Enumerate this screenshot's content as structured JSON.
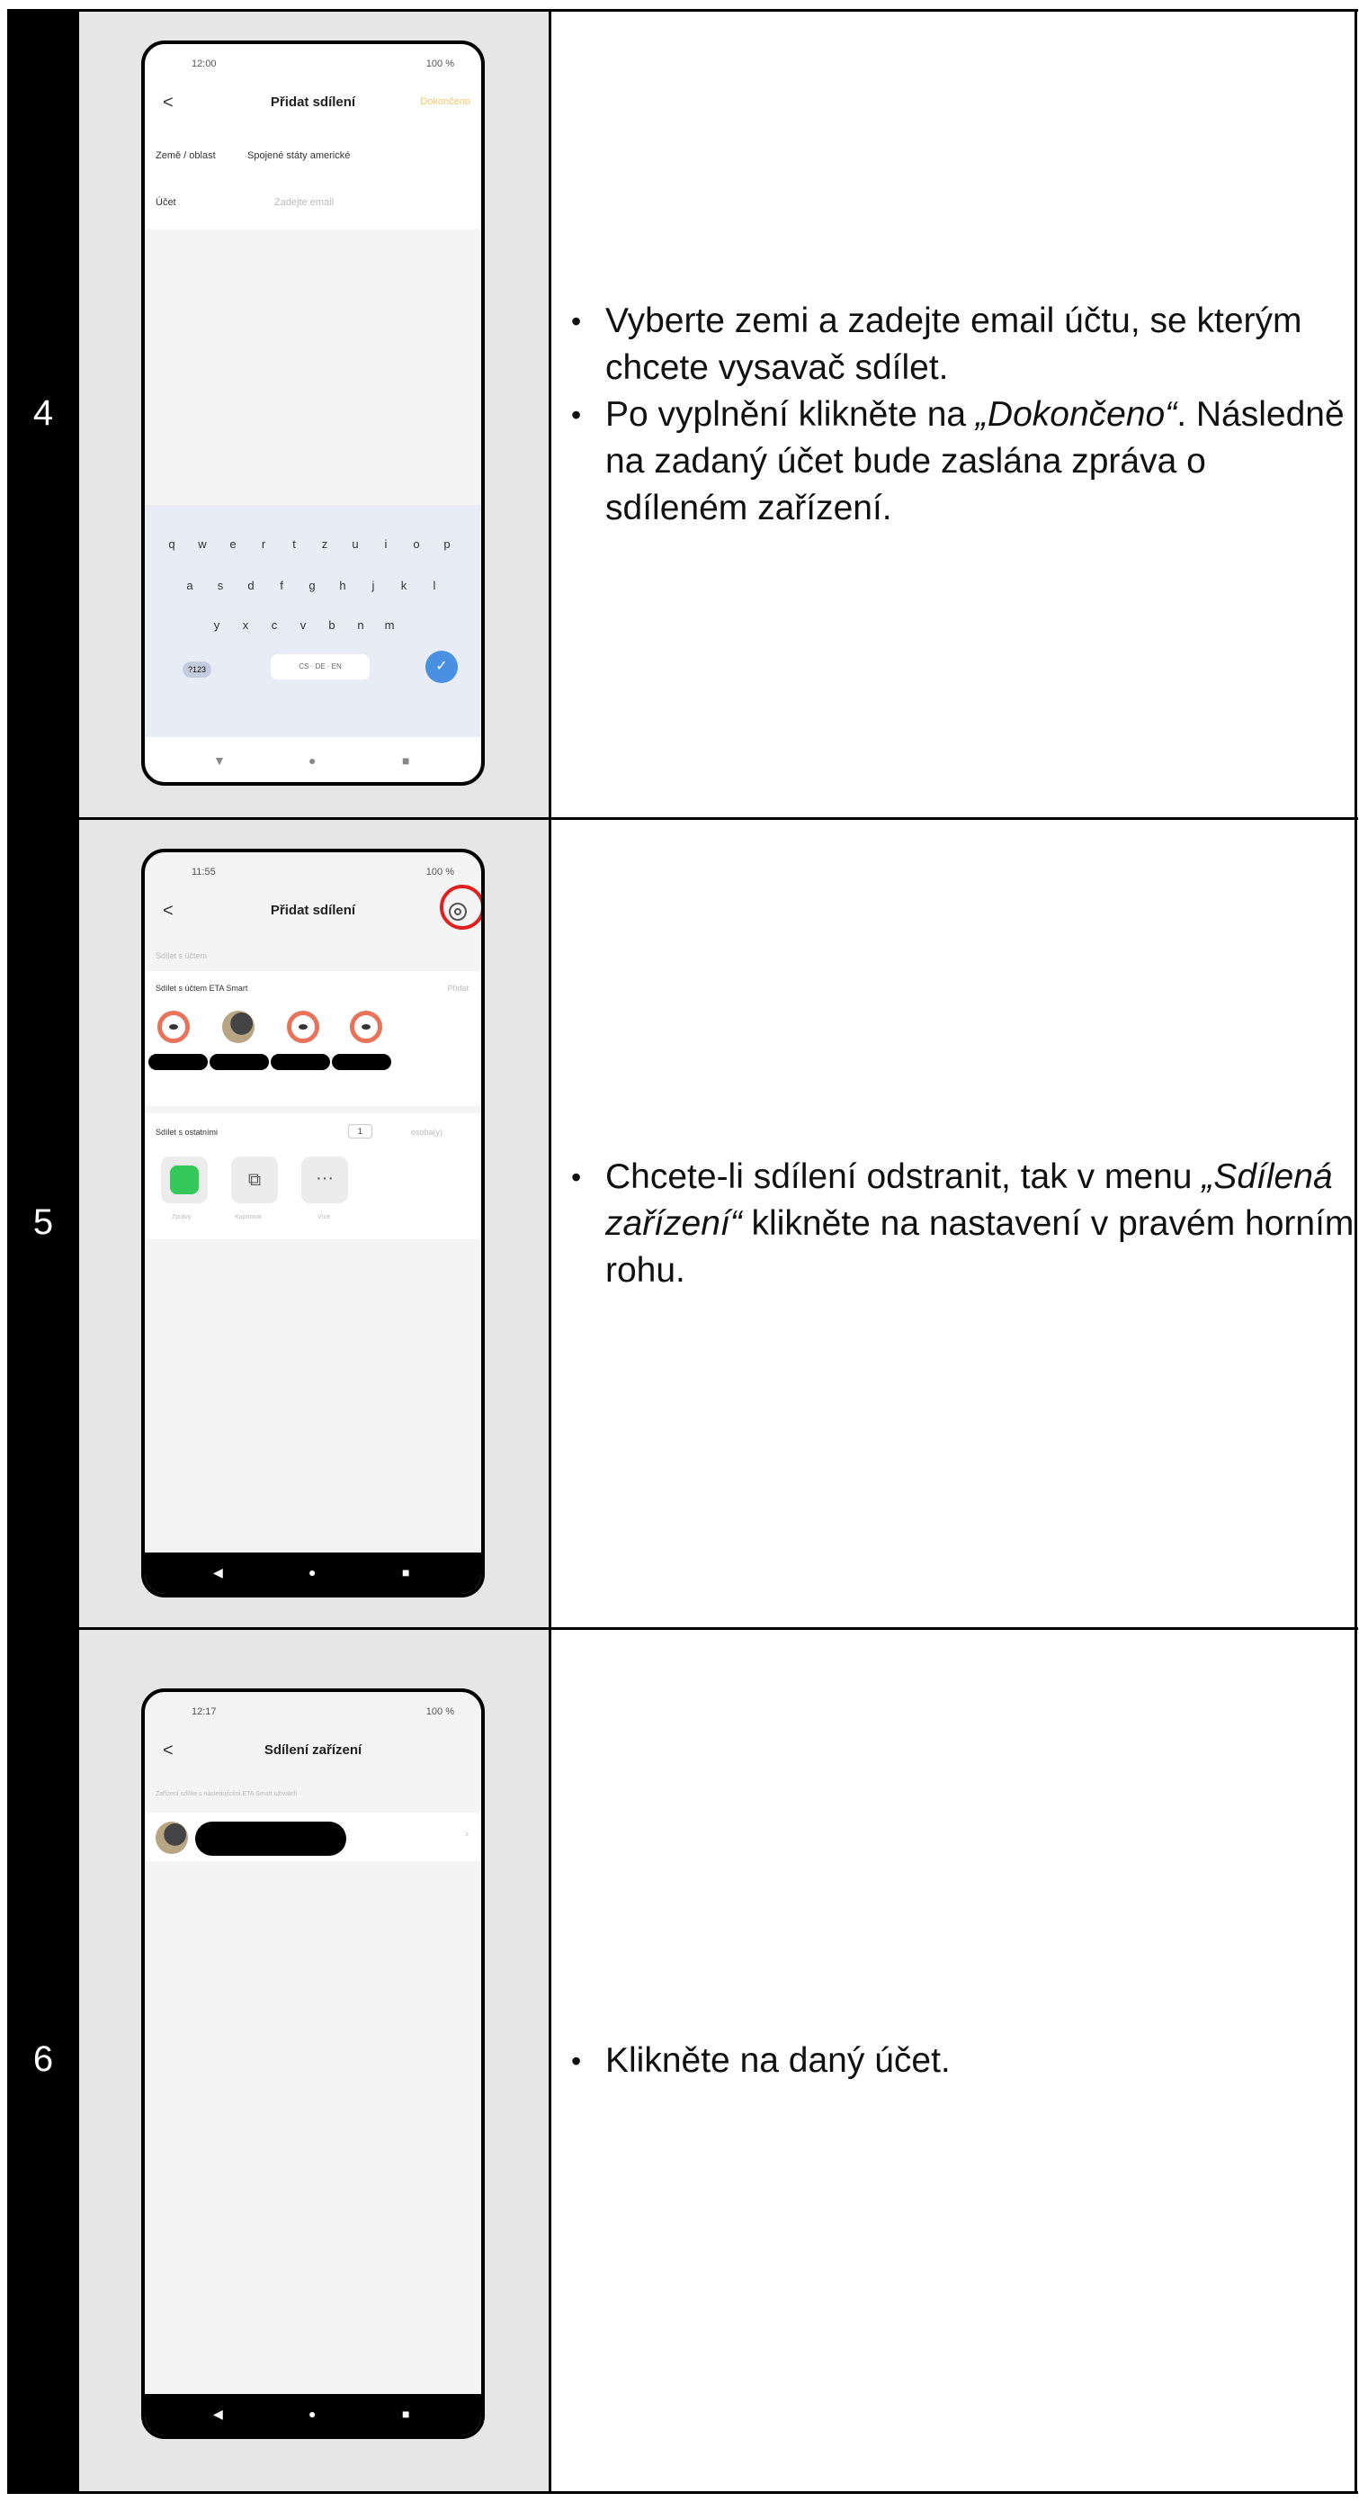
{
  "rows": [
    {
      "step": "4",
      "phone": {
        "status_time": "12:00",
        "status_right": "100 %",
        "back": "<",
        "title": "Přidat sdílení",
        "done_label": "Dokončeno",
        "country_label": "Země / oblast",
        "country_value": "Spojené státy americké",
        "account_label": "Účet",
        "account_placeholder": "Zadejte email",
        "keyboard_row1": [
          "q",
          "w",
          "e",
          "r",
          "t",
          "z",
          "u",
          "i",
          "o",
          "p"
        ],
        "keyboard_row2": [
          "a",
          "s",
          "d",
          "f",
          "g",
          "h",
          "j",
          "k",
          "l"
        ],
        "keyboard_row3": [
          "y",
          "x",
          "c",
          "v",
          "b",
          "n",
          "m"
        ],
        "keyboard_mode": "?123",
        "keyboard_space": "CS · DE · EN"
      },
      "bullets": [
        {
          "pre": "Vyberte zemi a zadejte email účtu, se kterým chcete vysavač sdílet.",
          "em": "",
          "post": ""
        },
        {
          "pre": "Po vyplnění klikněte na ",
          "em": "„Dokončeno“",
          "post": ". Následně na zadaný účet bude zaslána zpráva o sdíleném zařízení."
        }
      ]
    },
    {
      "step": "5",
      "phone": {
        "status_time": "11:55",
        "status_right": "100 %",
        "back": "<",
        "title": "Přidat sdílení",
        "section": "Sdílet s účtem",
        "share_with": "Sdílet s účtem ETA Smart",
        "add_label": "Přidat",
        "share_others": "Sdílet s ostatními",
        "count": "1",
        "unit": "osoba(y)",
        "icon_labels": [
          "Zprávy",
          "Kopírovat",
          "Více"
        ]
      },
      "bullets": [
        {
          "pre": "Chcete-li sdílení odstranit, tak v menu ",
          "em": "„Sdílená zařízení“",
          "post": " klikněte na nastavení v pravém horním rohu."
        }
      ]
    },
    {
      "step": "6",
      "phone": {
        "status_time": "12:17",
        "status_right": "100 %",
        "back": "<",
        "title": "Sdílení zařízení",
        "subtitle": "Zařízení sdílíte s následujícími ETA Smart uživateli"
      },
      "bullets": [
        {
          "pre": "Klikněte na daný účet.",
          "em": "",
          "post": ""
        }
      ]
    }
  ],
  "nav_glyphs": {
    "back": "◀",
    "home": "●",
    "recent": "■",
    "down": "▼"
  },
  "bullet_glyph": "•",
  "colors": {
    "highlight": "#e02020",
    "accent_done": "#f6c66a",
    "keyboard_ok": "#4a90e2"
  }
}
